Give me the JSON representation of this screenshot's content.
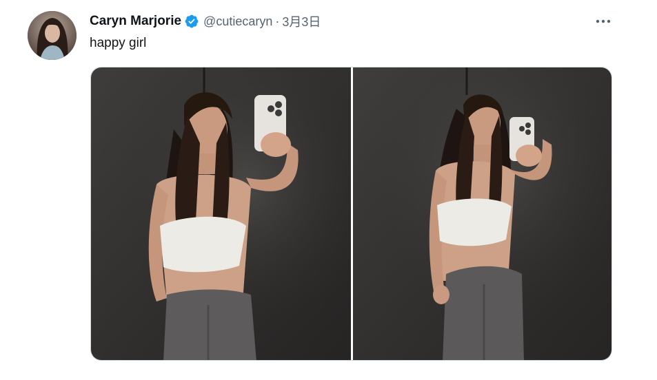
{
  "tweet": {
    "author": {
      "display_name": "Caryn Marjorie",
      "handle": "@cutiecaryn",
      "verified": true,
      "avatar_icon": "profile-avatar"
    },
    "separator": "·",
    "date": "3月3日",
    "text": "happy girl",
    "more_icon": "more-horizontal-icon",
    "media": [
      {
        "kind": "photo",
        "icon": "photo-1"
      },
      {
        "kind": "photo",
        "icon": "photo-2"
      }
    ]
  },
  "colors": {
    "verified_blue": "#1d9bf0",
    "secondary_text": "#536471",
    "primary_text": "#0f1419",
    "media_border": "#cfd9de"
  }
}
